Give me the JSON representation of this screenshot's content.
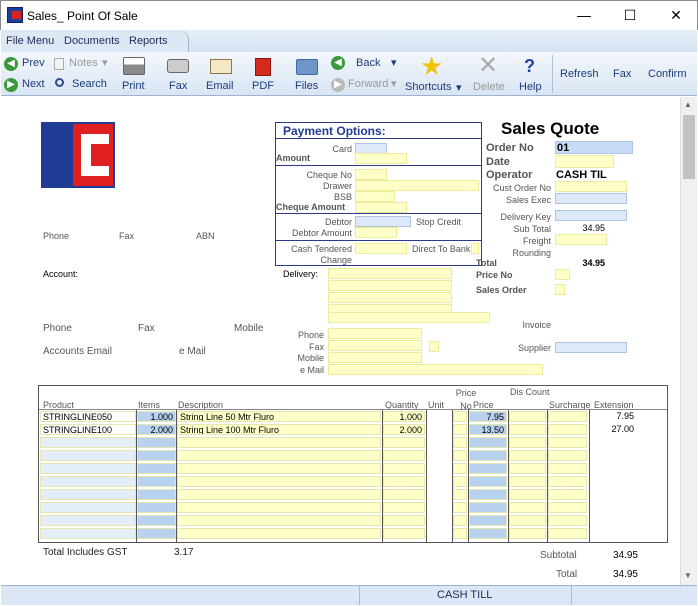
{
  "window": {
    "title": "Sales_ Point Of Sale"
  },
  "menu": {
    "file": "File Menu",
    "documents": "Documents",
    "reports": "Reports"
  },
  "toolbar": {
    "prev": "Prev",
    "next": "Next",
    "notes": "Notes",
    "search": "Search",
    "print": "Print",
    "fax": "Fax",
    "email": "Email",
    "pdf": "PDF",
    "files": "Files",
    "back": "Back",
    "forward": "Forward",
    "shortcuts": "Shortcuts",
    "delete": "Delete",
    "help": "Help",
    "refresh": "Refresh",
    "fax2": "Fax",
    "confirm": "Confirm"
  },
  "payment": {
    "title": "Payment Options:",
    "card": "Card",
    "amount": "Amount",
    "cheque_no": "Cheque No",
    "drawer": "Drawer",
    "bsb": "BSB",
    "cheque_amount": "Cheque Amount",
    "debtor": "Debtor",
    "stop_credit": "Stop Credit",
    "debtor_amount": "Debtor Amount",
    "cash_tendered": "Cash Tendered",
    "direct_to_bank": "Direct To Bank",
    "change": "Change"
  },
  "quote": {
    "title": "Sales Quote",
    "order_no_label": "Order No",
    "order_no": "01",
    "date_label": "Date",
    "operator_label": "Operator",
    "operator": "CASH TIL",
    "cust_order_label": "Cust Order No",
    "sales_exec_label": "Sales Exec",
    "delivery_key_label": "Delivery Key",
    "subtotal_label": "Sub Total",
    "subtotal": "34.95",
    "freight_label": "Freight",
    "rounding_label": "Rounding",
    "total_label": "Total",
    "total": "34.95",
    "price_no_label": "Price No",
    "sales_order_label": "Sales Order",
    "invoice_label": "Invoice",
    "supplier_label": "Supplier"
  },
  "customer": {
    "phone": "Phone",
    "fax": "Fax",
    "abn": "ABN",
    "account": "Account:",
    "delivery": "Delivery:",
    "phone2": "Phone",
    "fax2": "Fax",
    "mobile": "Mobile",
    "accounts_email": "Accounts Email",
    "email": "e Mail",
    "dphone": "Phone",
    "dfax": "Fax",
    "dmobile": "Mobile",
    "demail": "e Mail"
  },
  "grid": {
    "headers": {
      "product": "Product",
      "items": "Items",
      "description": "Description",
      "quantity": "Quantity",
      "unit": "Unit",
      "price_no": "Price No",
      "price": "Price",
      "disc_count": "Dis Count",
      "surcharge": "Surcharge",
      "extension": "Extension"
    },
    "rows": [
      {
        "product": "STRINGLINE050",
        "items": "1.000",
        "description": "String Line 50 Mtr Fluro",
        "quantity": "1.000",
        "price": "7.95",
        "extension": "7.95"
      },
      {
        "product": "STRINGLINE100",
        "items": "2.000",
        "description": "String Line 100 Mtr Fluro",
        "quantity": "2.000",
        "price": "13.50",
        "extension": "27.00"
      }
    ]
  },
  "footer": {
    "gst_label": "Total Includes GST",
    "gst": "3.17",
    "subtotal_label": "Subtotal",
    "subtotal": "34.95",
    "total_label": "Total",
    "total": "34.95"
  },
  "status": {
    "operator": "CASH TILL"
  }
}
